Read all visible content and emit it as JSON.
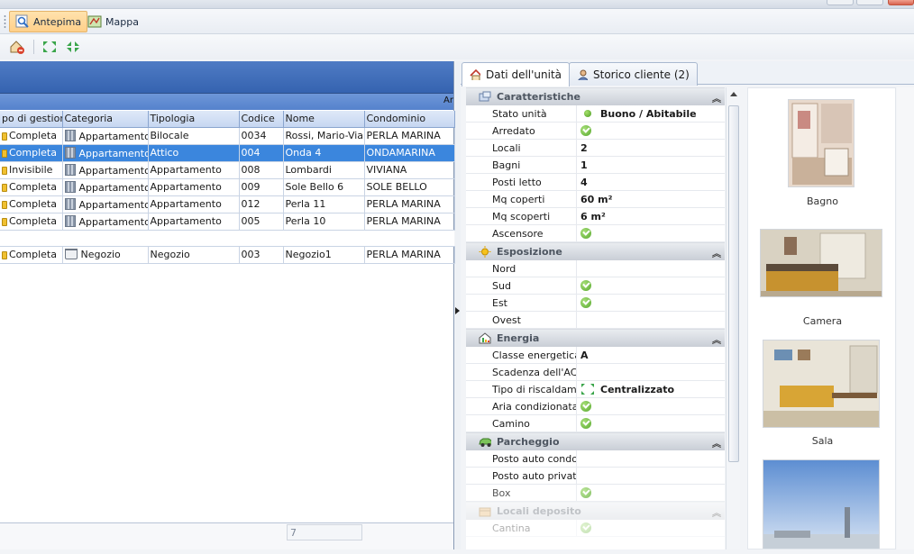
{
  "toolbar": {
    "preview_label": "Antepima",
    "map_label": "Mappa"
  },
  "grid": {
    "subheader_right": "Ar",
    "columns": [
      "po di gestione",
      "Categoria",
      "Tipologia",
      "Codice",
      "Nome",
      "Condominio"
    ],
    "rows": [
      {
        "gestione": "Completa",
        "categoria": "Appartamento",
        "tipologia": "Bilocale",
        "codice": "0034",
        "nome": "Rossi, Mario-Viale",
        "condominio": "PERLA MARINA"
      },
      {
        "gestione": "Completa",
        "categoria": "Appartamento",
        "tipologia": "Attico",
        "codice": "004",
        "nome": "Onda 4",
        "condominio": "ONDAMARINA"
      },
      {
        "gestione": "Invisibile",
        "categoria": "Appartamento",
        "tipologia": "Appartamento",
        "codice": "008",
        "nome": "Lombardi",
        "condominio": "VIVIANA"
      },
      {
        "gestione": "Completa",
        "categoria": "Appartamento",
        "tipologia": "Appartamento",
        "codice": "009",
        "nome": "Sole Bello 6",
        "condominio": "SOLE BELLO"
      },
      {
        "gestione": "Completa",
        "categoria": "Appartamento",
        "tipologia": "Appartamento",
        "codice": "012",
        "nome": "Perla 11",
        "condominio": "PERLA MARINA"
      },
      {
        "gestione": "Completa",
        "categoria": "Appartamento",
        "tipologia": "Appartamento",
        "codice": "005",
        "nome": "Perla 10",
        "condominio": "PERLA MARINA"
      },
      {
        "gestione": "Completa",
        "categoria": "Negozio",
        "tipologia": "Negozio",
        "codice": "003",
        "nome": "Negozio1",
        "condominio": "PERLA MARINA"
      }
    ],
    "footer_count": "7"
  },
  "tabs": {
    "unit_data": "Dati dell'unità",
    "client_history": "Storico cliente (2)"
  },
  "props": {
    "caratteristiche": {
      "title": "Caratteristiche",
      "stato_label": "Stato unità",
      "stato_value": "Buono / Abitabile",
      "arredato_label": "Arredato",
      "locali_label": "Locali",
      "locali_value": "2",
      "bagni_label": "Bagni",
      "bagni_value": "1",
      "posti_label": "Posti letto",
      "posti_value": "4",
      "mqc_label": "Mq coperti",
      "mqc_value": "60 m²",
      "mqs_label": "Mq scoperti",
      "mqs_value": "6 m²",
      "ascensore_label": "Ascensore"
    },
    "esposizione": {
      "title": "Esposizione",
      "nord": "Nord",
      "sud": "Sud",
      "est": "Est",
      "ovest": "Ovest"
    },
    "energia": {
      "title": "Energia",
      "classe_label": "Classe energetica",
      "classe_value": "A",
      "scadenza_label": "Scadenza dell'ACE",
      "riscald_label": "Tipo di riscaldamen",
      "riscald_value": "Centralizzato",
      "aria_label": "Aria condizionata",
      "camino_label": "Camino"
    },
    "parcheggio": {
      "title": "Parcheggio",
      "condom_label": "Posto auto condom",
      "privato_label": "Posto auto privato",
      "box_label": "Box"
    },
    "deposito": {
      "title": "Locali deposito",
      "cantina_label": "Cantina"
    }
  },
  "gallery": {
    "captions": [
      "Bagno",
      "Camera",
      "Sala"
    ]
  },
  "colors": {
    "grid_header": "#3563b0",
    "selection": "#3b86dd",
    "check_green": "#56a82c"
  }
}
